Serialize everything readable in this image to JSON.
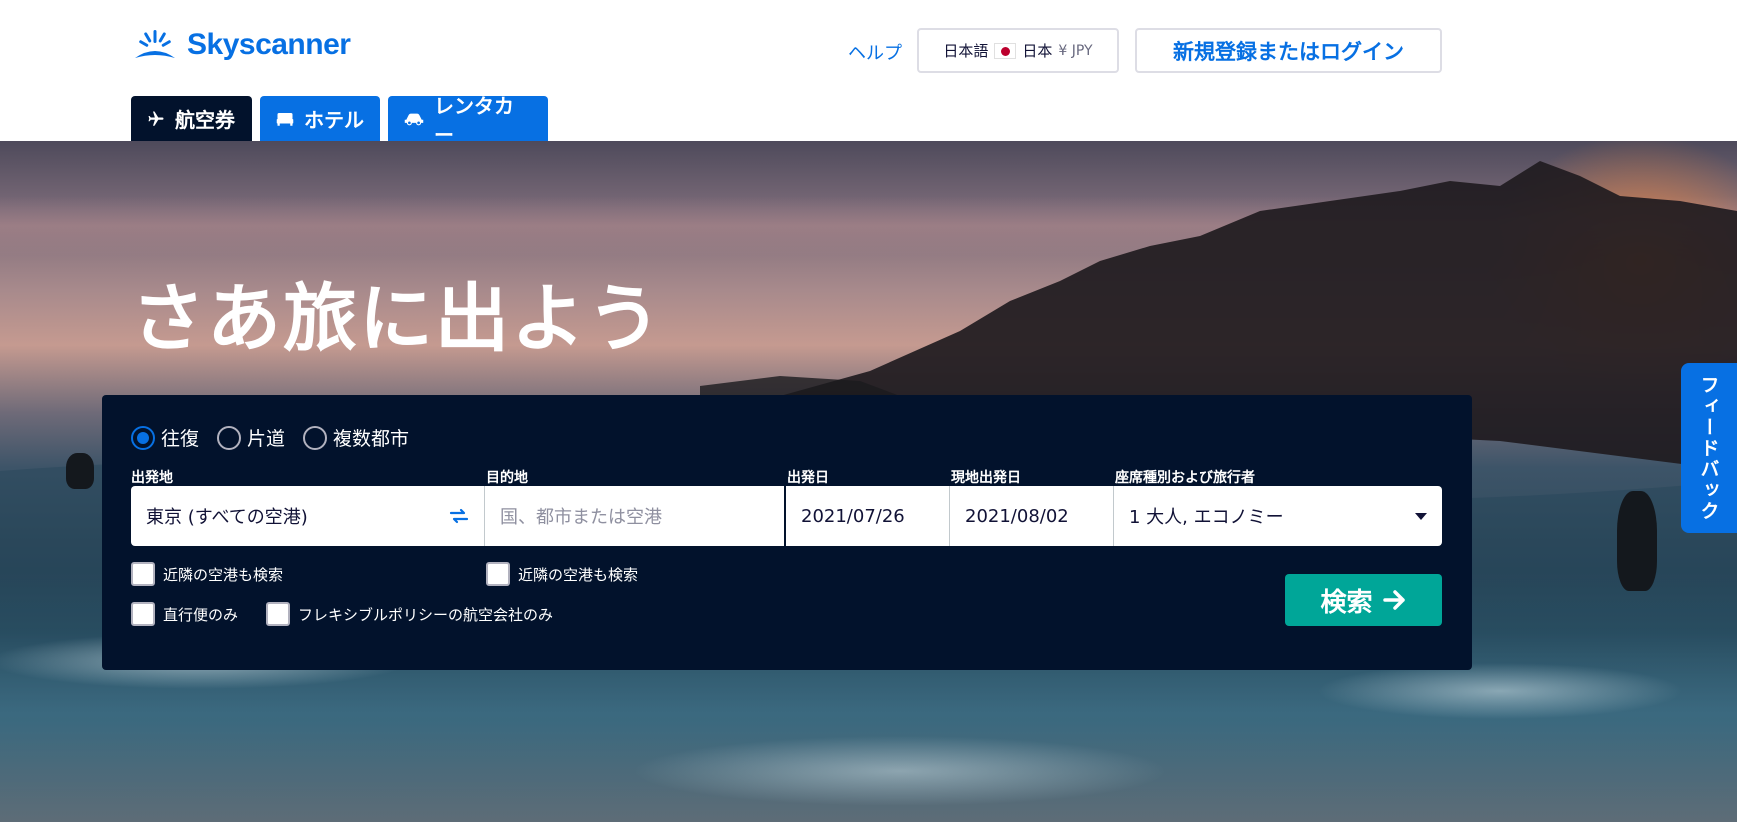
{
  "header": {
    "logo_text": "Skyscanner",
    "help_label": "ヘルプ",
    "locale": {
      "language": "日本語",
      "country": "日本",
      "currency": "¥ JPY"
    },
    "login_label": "新規登録またはログイン"
  },
  "tabs": [
    {
      "label": "航空券",
      "icon": "plane-icon",
      "active": true
    },
    {
      "label": "ホテル",
      "icon": "bed-icon",
      "active": false
    },
    {
      "label": "レンタカー",
      "icon": "car-icon",
      "active": false
    }
  ],
  "hero": {
    "title": "さあ旅に出よう",
    "feedback_label": "フィードバック"
  },
  "search": {
    "trip_types": [
      {
        "label": "往復",
        "checked": true
      },
      {
        "label": "片道",
        "checked": false
      },
      {
        "label": "複数都市",
        "checked": false
      }
    ],
    "origin": {
      "label": "出発地",
      "value": "東京 (すべての空港)"
    },
    "destination": {
      "label": "目的地",
      "placeholder": "国、都市または空港"
    },
    "depart": {
      "label": "出発日",
      "value": "2021/07/26"
    },
    "return": {
      "label": "現地出発日",
      "value": "2021/08/02"
    },
    "cabin": {
      "label": "座席種別および旅行者",
      "value": "1 大人, エコノミー"
    },
    "options": {
      "nearby_origin": "近隣の空港も検索",
      "nearby_destination": "近隣の空港も検索",
      "direct_only": "直行便のみ",
      "flexible_policy": "フレキシブルポリシーの航空会社のみ"
    },
    "search_button": "検索"
  },
  "colors": {
    "brand_blue": "#0770e3",
    "navy": "#02122c",
    "search_green": "#00a698"
  }
}
